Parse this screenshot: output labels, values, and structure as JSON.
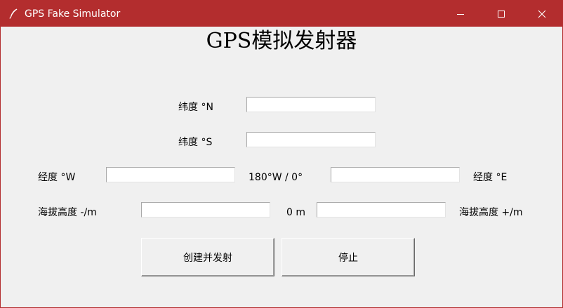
{
  "window": {
    "title": "GPS Fake Simulator",
    "icon": "feather-icon",
    "controls": [
      "minimize-icon",
      "maximize-icon",
      "close-icon"
    ],
    "title_bar_color": "#b32d2e"
  },
  "heading": "GPS模拟发射器",
  "fields": {
    "lat_north_label": "纬度 °N",
    "lat_south_label": "纬度 °S",
    "lon_west_label": "经度 °W",
    "lon_middle_label": "180°W / 0°",
    "lon_east_label": "经度 °E",
    "alt_neg_label": "海拔高度 -/m",
    "alt_middle_label": "0 m",
    "alt_pos_label": "海拔高度 +/m",
    "lat_north_value": "",
    "lat_south_value": "",
    "lon_west_value": "",
    "lon_east_value": "",
    "alt_neg_value": "",
    "alt_pos_value": ""
  },
  "buttons": {
    "start_label": "创建并发射",
    "stop_label": "停止"
  }
}
